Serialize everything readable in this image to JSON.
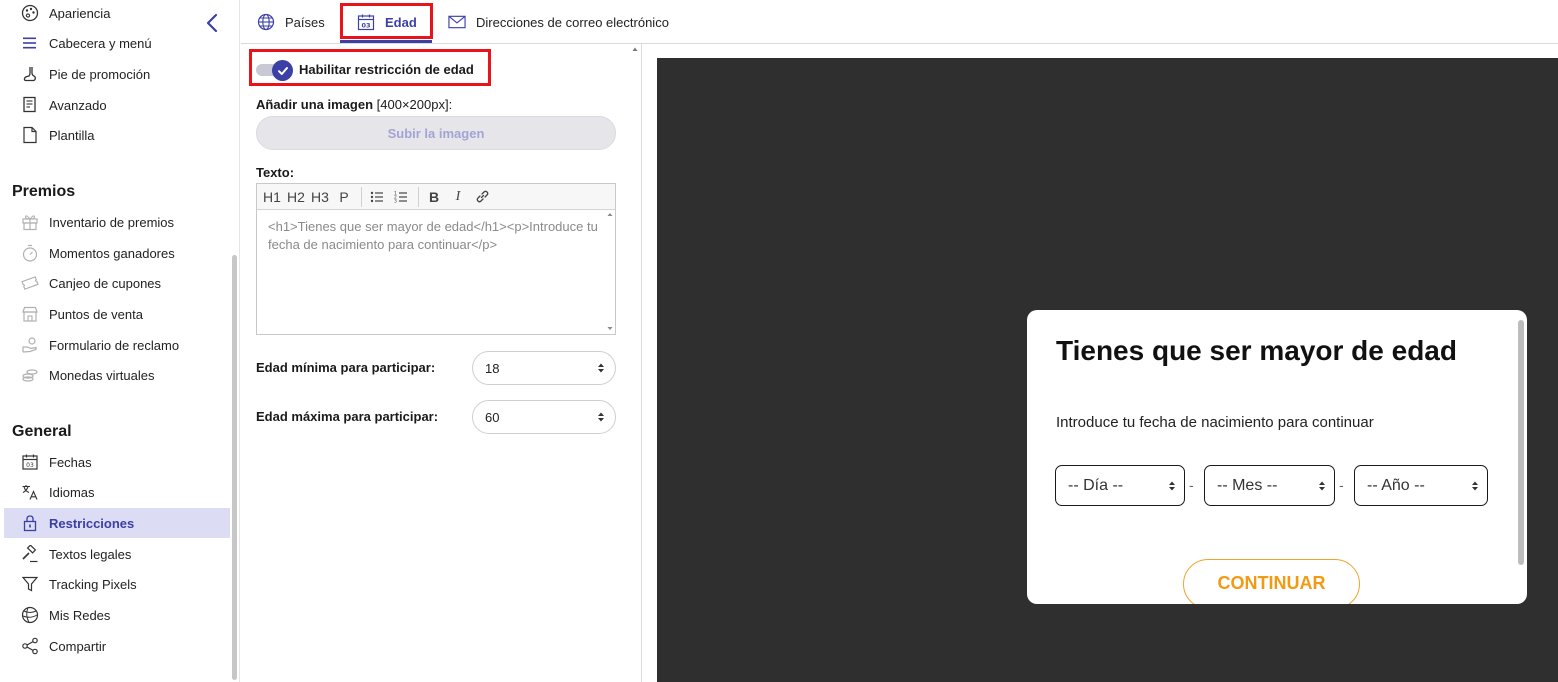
{
  "sidebar": {
    "top_items": [
      {
        "label": "Apariencia",
        "icon": "palette-icon"
      },
      {
        "label": "Cabecera y menú",
        "icon": "menu-icon"
      },
      {
        "label": "Pie de promoción",
        "icon": "foot-icon"
      },
      {
        "label": "Avanzado",
        "icon": "document-settings-icon"
      },
      {
        "label": "Plantilla",
        "icon": "file-icon"
      }
    ],
    "premios_title": "Premios",
    "premios_items": [
      {
        "label": "Inventario de premios",
        "icon": "gift-icon"
      },
      {
        "label": "Momentos ganadores",
        "icon": "stopwatch-icon"
      },
      {
        "label": "Canjeo de cupones",
        "icon": "coupon-icon"
      },
      {
        "label": "Puntos de venta",
        "icon": "store-icon"
      },
      {
        "label": "Formulario de reclamo",
        "icon": "hand-coin-icon"
      },
      {
        "label": "Monedas virtuales",
        "icon": "coins-icon"
      }
    ],
    "general_title": "General",
    "general_items": [
      {
        "label": "Fechas",
        "icon": "calendar-icon"
      },
      {
        "label": "Idiomas",
        "icon": "translate-icon"
      },
      {
        "label": "Restricciones",
        "icon": "lock-icon"
      },
      {
        "label": "Textos legales",
        "icon": "gavel-icon"
      },
      {
        "label": "Tracking Pixels",
        "icon": "filter-icon"
      },
      {
        "label": "Mis Redes",
        "icon": "globe-network-icon"
      },
      {
        "label": "Compartir",
        "icon": "share-icon"
      }
    ],
    "active_item": "Restricciones"
  },
  "tabs": [
    {
      "label": "Países",
      "icon": "globe-icon",
      "active": false
    },
    {
      "label": "Edad",
      "icon": "calendar-icon",
      "calendar_day": "03",
      "active": true
    },
    {
      "label": "Direcciones de correo electrónico",
      "icon": "envelope-icon",
      "active": false
    }
  ],
  "form": {
    "toggle_label": "Habilitar restricción de edad",
    "toggle_on": true,
    "image_label_bold": "Añadir una imagen",
    "image_label_size": "[400×200px]:",
    "upload_button": "Subir la imagen",
    "text_label": "Texto:",
    "toolbar": [
      "H1",
      "H2",
      "H3",
      "P",
      "bulleted-list-icon",
      "numbered-list-icon",
      "B",
      "I",
      "link-icon"
    ],
    "editor_content": "<h1>Tienes que ser mayor de edad</h1><p>Introduce tu fecha de nacimiento para continuar</p>",
    "min_age_label": "Edad mínima para participar:",
    "min_age_value": "18",
    "max_age_label": "Edad máxima para participar:",
    "max_age_value": "60"
  },
  "preview": {
    "title": "Tienes que ser mayor de edad",
    "subtitle": "Introduce tu fecha de nacimiento para continuar",
    "day_placeholder": "-- Día --",
    "month_placeholder": "-- Mes --",
    "year_placeholder": "-- Año --",
    "separator": "-",
    "continue_button": "CONTINUAR"
  },
  "colors": {
    "accent": "#3b3fa6",
    "highlight_box": "#e8141a",
    "continue": "#f39a12",
    "preview_bg": "#2f2f2f",
    "active_sidebar_bg": "#dcdcf4"
  }
}
